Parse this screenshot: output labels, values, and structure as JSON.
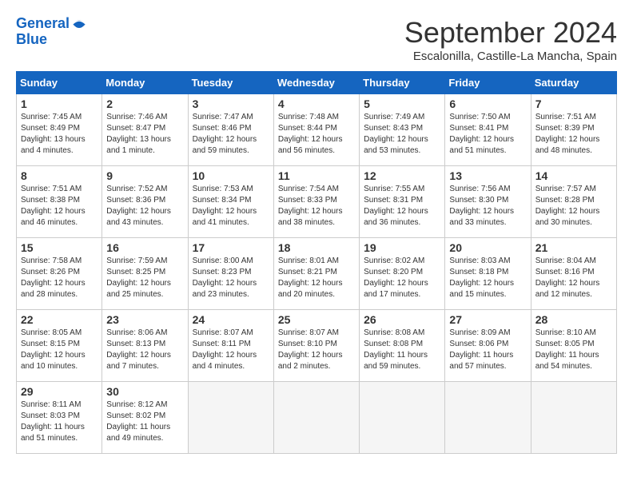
{
  "header": {
    "logo_line1": "General",
    "logo_line2": "Blue",
    "month": "September 2024",
    "location": "Escalonilla, Castille-La Mancha, Spain"
  },
  "weekdays": [
    "Sunday",
    "Monday",
    "Tuesday",
    "Wednesday",
    "Thursday",
    "Friday",
    "Saturday"
  ],
  "weeks": [
    [
      {
        "day": "1",
        "rise": "7:45 AM",
        "set": "8:49 PM",
        "daylight": "13 hours and 4 minutes."
      },
      {
        "day": "2",
        "rise": "7:46 AM",
        "set": "8:47 PM",
        "daylight": "13 hours and 1 minute."
      },
      {
        "day": "3",
        "rise": "7:47 AM",
        "set": "8:46 PM",
        "daylight": "12 hours and 59 minutes."
      },
      {
        "day": "4",
        "rise": "7:48 AM",
        "set": "8:44 PM",
        "daylight": "12 hours and 56 minutes."
      },
      {
        "day": "5",
        "rise": "7:49 AM",
        "set": "8:43 PM",
        "daylight": "12 hours and 53 minutes."
      },
      {
        "day": "6",
        "rise": "7:50 AM",
        "set": "8:41 PM",
        "daylight": "12 hours and 51 minutes."
      },
      {
        "day": "7",
        "rise": "7:51 AM",
        "set": "8:39 PM",
        "daylight": "12 hours and 48 minutes."
      }
    ],
    [
      {
        "day": "8",
        "rise": "7:51 AM",
        "set": "8:38 PM",
        "daylight": "12 hours and 46 minutes."
      },
      {
        "day": "9",
        "rise": "7:52 AM",
        "set": "8:36 PM",
        "daylight": "12 hours and 43 minutes."
      },
      {
        "day": "10",
        "rise": "7:53 AM",
        "set": "8:34 PM",
        "daylight": "12 hours and 41 minutes."
      },
      {
        "day": "11",
        "rise": "7:54 AM",
        "set": "8:33 PM",
        "daylight": "12 hours and 38 minutes."
      },
      {
        "day": "12",
        "rise": "7:55 AM",
        "set": "8:31 PM",
        "daylight": "12 hours and 36 minutes."
      },
      {
        "day": "13",
        "rise": "7:56 AM",
        "set": "8:30 PM",
        "daylight": "12 hours and 33 minutes."
      },
      {
        "day": "14",
        "rise": "7:57 AM",
        "set": "8:28 PM",
        "daylight": "12 hours and 30 minutes."
      }
    ],
    [
      {
        "day": "15",
        "rise": "7:58 AM",
        "set": "8:26 PM",
        "daylight": "12 hours and 28 minutes."
      },
      {
        "day": "16",
        "rise": "7:59 AM",
        "set": "8:25 PM",
        "daylight": "12 hours and 25 minutes."
      },
      {
        "day": "17",
        "rise": "8:00 AM",
        "set": "8:23 PM",
        "daylight": "12 hours and 23 minutes."
      },
      {
        "day": "18",
        "rise": "8:01 AM",
        "set": "8:21 PM",
        "daylight": "12 hours and 20 minutes."
      },
      {
        "day": "19",
        "rise": "8:02 AM",
        "set": "8:20 PM",
        "daylight": "12 hours and 17 minutes."
      },
      {
        "day": "20",
        "rise": "8:03 AM",
        "set": "8:18 PM",
        "daylight": "12 hours and 15 minutes."
      },
      {
        "day": "21",
        "rise": "8:04 AM",
        "set": "8:16 PM",
        "daylight": "12 hours and 12 minutes."
      }
    ],
    [
      {
        "day": "22",
        "rise": "8:05 AM",
        "set": "8:15 PM",
        "daylight": "12 hours and 10 minutes."
      },
      {
        "day": "23",
        "rise": "8:06 AM",
        "set": "8:13 PM",
        "daylight": "12 hours and 7 minutes."
      },
      {
        "day": "24",
        "rise": "8:07 AM",
        "set": "8:11 PM",
        "daylight": "12 hours and 4 minutes."
      },
      {
        "day": "25",
        "rise": "8:07 AM",
        "set": "8:10 PM",
        "daylight": "12 hours and 2 minutes."
      },
      {
        "day": "26",
        "rise": "8:08 AM",
        "set": "8:08 PM",
        "daylight": "11 hours and 59 minutes."
      },
      {
        "day": "27",
        "rise": "8:09 AM",
        "set": "8:06 PM",
        "daylight": "11 hours and 57 minutes."
      },
      {
        "day": "28",
        "rise": "8:10 AM",
        "set": "8:05 PM",
        "daylight": "11 hours and 54 minutes."
      }
    ],
    [
      {
        "day": "29",
        "rise": "8:11 AM",
        "set": "8:03 PM",
        "daylight": "11 hours and 51 minutes."
      },
      {
        "day": "30",
        "rise": "8:12 AM",
        "set": "8:02 PM",
        "daylight": "11 hours and 49 minutes."
      },
      null,
      null,
      null,
      null,
      null
    ]
  ]
}
